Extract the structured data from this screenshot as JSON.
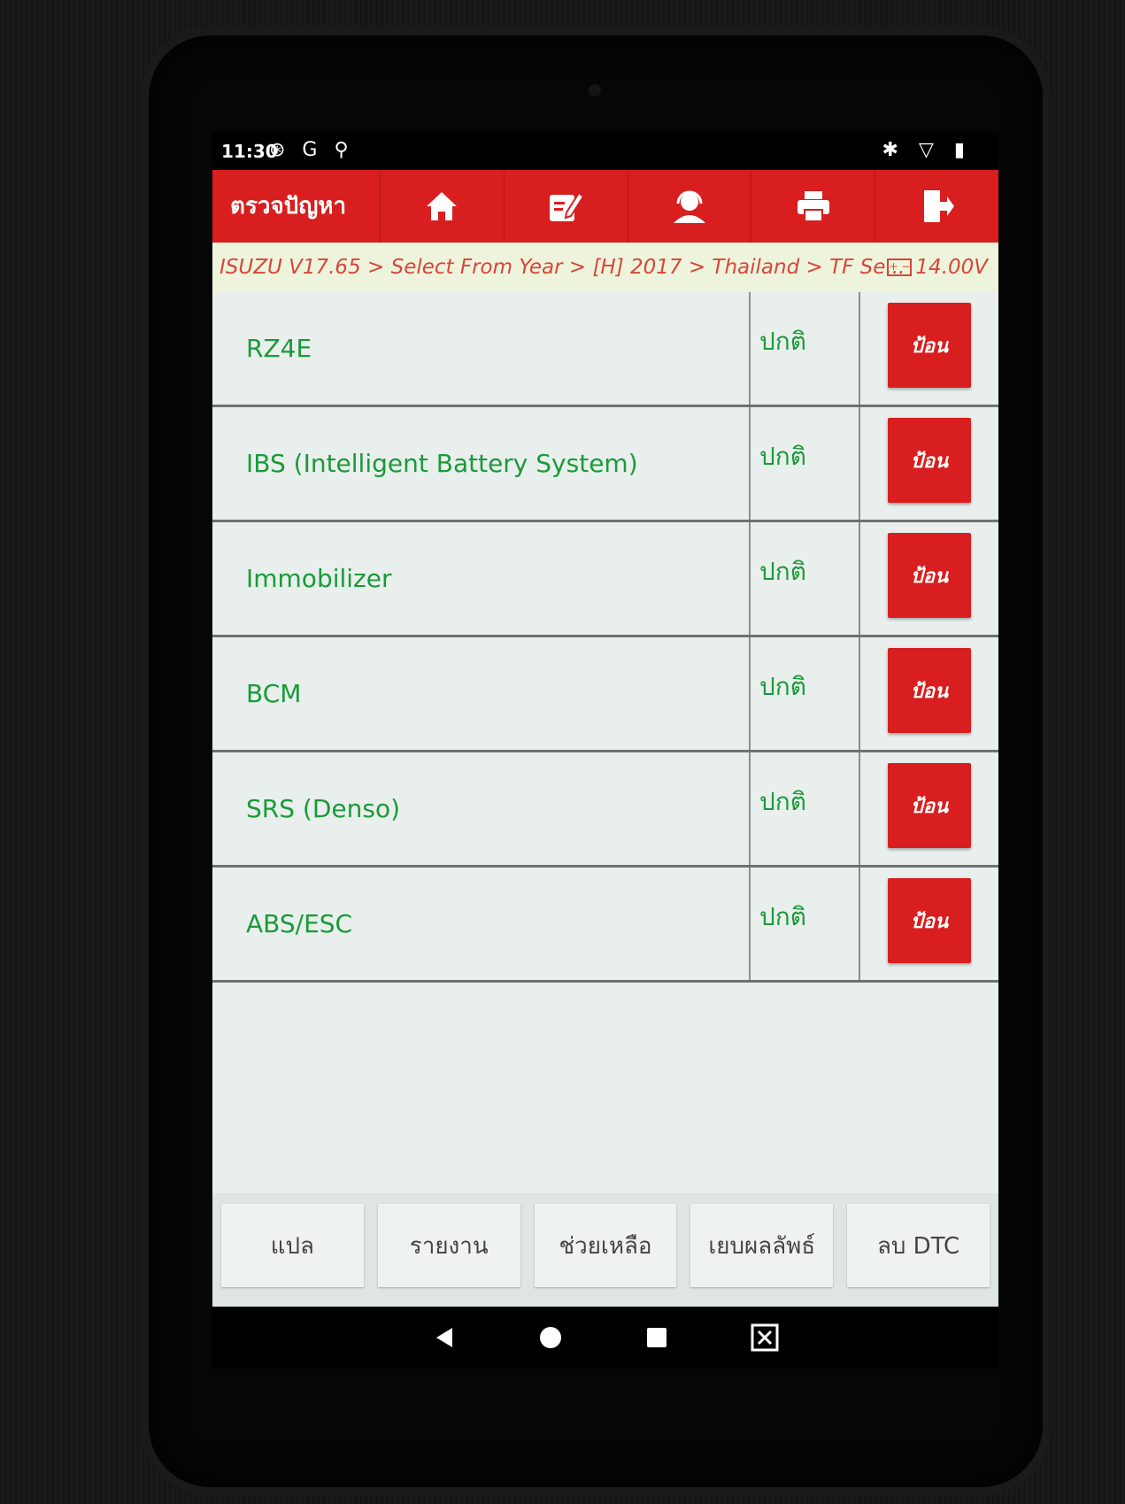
{
  "status_bar": {
    "time": "11:30",
    "left_icons": "⊛ G ⚲",
    "right_icons": "✱ ▽ ▮"
  },
  "toolbar": {
    "title": "ตรวจปัญหา",
    "icons": [
      "home-icon",
      "edit-icon",
      "support-icon",
      "print-icon",
      "exit-icon"
    ]
  },
  "breadcrumb": {
    "path": "ISUZU V17.65 > Select From Year > [H] 2017 > Thailand > TF Se...",
    "voltage": "14.00V"
  },
  "systems": [
    {
      "name": "RZ4E",
      "status": "ปกติ",
      "action": "ป้อน"
    },
    {
      "name": "IBS (Intelligent Battery System)",
      "status": "ปกติ",
      "action": "ป้อน"
    },
    {
      "name": "Immobilizer",
      "status": "ปกติ",
      "action": "ป้อน"
    },
    {
      "name": "BCM",
      "status": "ปกติ",
      "action": "ป้อน"
    },
    {
      "name": "SRS (Denso)",
      "status": "ปกติ",
      "action": "ป้อน"
    },
    {
      "name": "ABS/ESC",
      "status": "ปกติ",
      "action": "ป้อน"
    }
  ],
  "bottom_buttons": [
    "แปล",
    "รายงาน",
    "ช่วยเหลือ",
    "เยบผลลัพธ์",
    "ลบ DTC"
  ],
  "colors": {
    "accent_red": "#d81e1e",
    "text_green": "#1a9a3a",
    "crumb_red": "#d8463a"
  }
}
